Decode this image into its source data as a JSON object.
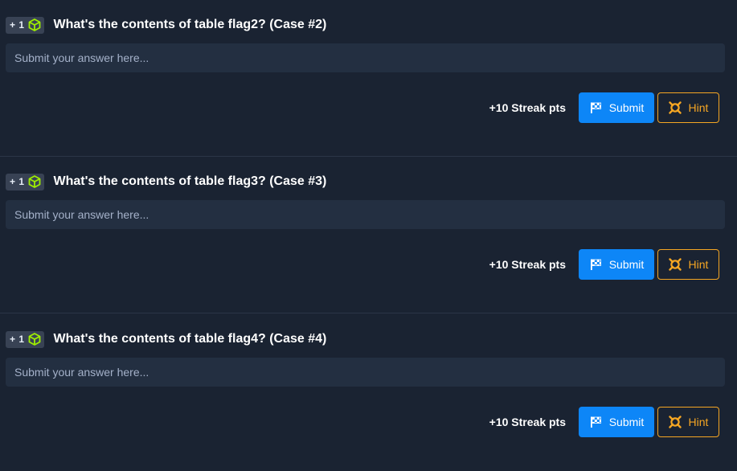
{
  "tasks": [
    {
      "badge": "+ 1",
      "question": "What's the contents of table flag2? (Case #2)",
      "placeholder": "Submit your answer here...",
      "streak": "+10 Streak pts",
      "submit_label": "Submit",
      "hint_label": "Hint"
    },
    {
      "badge": "+ 1",
      "question": "What's the contents of table flag3? (Case #3)",
      "placeholder": "Submit your answer here...",
      "streak": "+10 Streak pts",
      "submit_label": "Submit",
      "hint_label": "Hint"
    },
    {
      "badge": "+ 1",
      "question": "What's the contents of table flag4? (Case #4)",
      "placeholder": "Submit your answer here...",
      "streak": "+10 Streak pts",
      "submit_label": "Submit",
      "hint_label": "Hint"
    }
  ],
  "icons": {
    "badge": "cube-icon",
    "submit": "flag-icon",
    "hint": "hint-icon"
  },
  "colors": {
    "background": "#1a2332",
    "input_background": "#232f41",
    "submit_blue": "#0d86f7",
    "hint_orange": "#f5a623",
    "cube_green": "#9fef00"
  }
}
